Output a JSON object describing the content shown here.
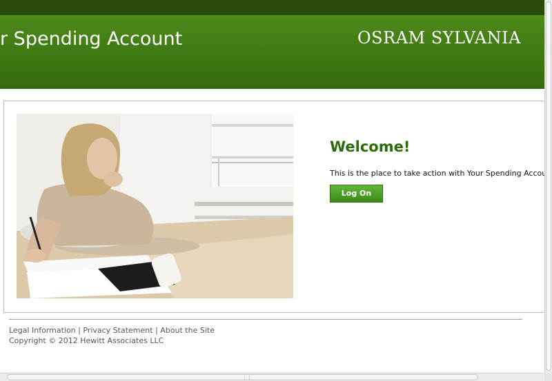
{
  "header": {
    "title": "r Spending Account",
    "brand": "OSRAM SYLVANIA"
  },
  "main": {
    "welcome": "Welcome!",
    "intro": "This is the place to take action with Your Spending Accou",
    "logon_label": "Log On"
  },
  "footer": {
    "links": [
      "Legal Information",
      "Privacy Statement",
      "About the Site"
    ],
    "separator": " | ",
    "copyright": "Copyright © 2012 Hewitt Associates LLC"
  },
  "colors": {
    "header_green": "#3f7812",
    "topbar": "#2a4a08",
    "welcome_green": "#2d6b0a",
    "button_green": "#4aa024"
  }
}
